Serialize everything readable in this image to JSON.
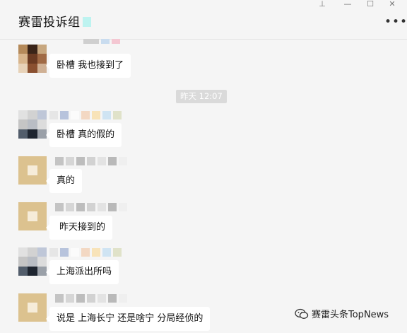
{
  "window": {
    "title": "赛雷投诉组"
  },
  "controls": {
    "pin": "⊥",
    "minimize": "—",
    "maximize": "☐",
    "close": "✕",
    "more": "•••"
  },
  "timestamp": "昨天 12:07",
  "messages": [
    {
      "text": "卧槽 我也接到了"
    },
    {
      "text": "卧槽 真的假的"
    },
    {
      "text": "真的"
    },
    {
      "text": "昨天接到的"
    },
    {
      "text": "上海派出所吗"
    },
    {
      "text": "说是 上海长宁  还是啥宁  分局经侦的"
    }
  ],
  "watermark": {
    "text": "赛雷头条TopNews"
  }
}
